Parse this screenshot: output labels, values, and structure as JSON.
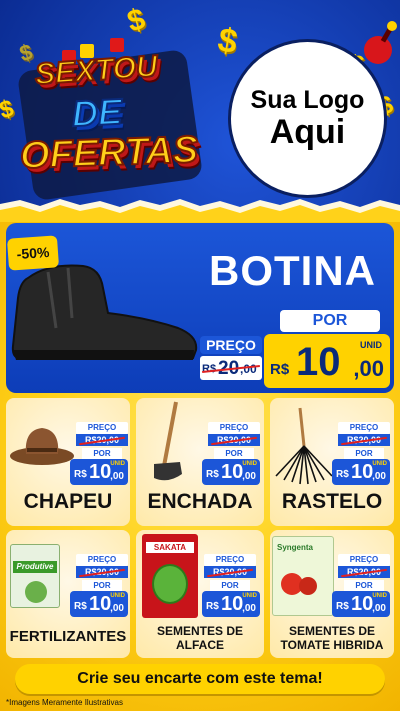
{
  "header": {
    "logo_line1": "SEXTOU",
    "logo_line2": "DE",
    "logo_line3": "OFERTAS",
    "brand_circle_line1": "Sua Logo",
    "brand_circle_line2": "Aqui",
    "dollar_glyph": "$"
  },
  "hero": {
    "discount_badge": "-50%",
    "title": "BOTINA",
    "preco_label": "PREÇO",
    "old_price_currency": "R$",
    "old_price_int": "20",
    "old_price_dec": ",00",
    "por_label": "POR",
    "unid_label": "UNID",
    "new_price_currency": "R$",
    "new_price_int": "10",
    "new_price_dec": ",00"
  },
  "products": [
    {
      "name": "CHAPEU",
      "preco": "PREÇO",
      "old": "R$20,00",
      "por": "POR",
      "cur": "R$",
      "int": "10",
      "dec": ",00",
      "unid": "UNID",
      "icon": "hat-icon"
    },
    {
      "name": "ENCHADA",
      "preco": "PREÇO",
      "old": "R$20,00",
      "por": "POR",
      "cur": "R$",
      "int": "10",
      "dec": ",00",
      "unid": "UNID",
      "icon": "hoe-icon"
    },
    {
      "name": "RASTELO",
      "preco": "PREÇO",
      "old": "R$20,00",
      "por": "POR",
      "cur": "R$",
      "int": "10",
      "dec": ",00",
      "unid": "UNID",
      "icon": "rake-icon"
    },
    {
      "name": "FERTILIZANTES",
      "preco": "PREÇO",
      "old": "R$20,00",
      "por": "POR",
      "cur": "R$",
      "int": "10",
      "dec": ",00",
      "unid": "UNID",
      "icon": "fertilizer-bag-icon",
      "pack_text": "Produtive"
    },
    {
      "name_l1": "SEMENTES DE",
      "name_l2": "ALFACE",
      "preco": "PREÇO",
      "old": "R$20,00",
      "por": "POR",
      "cur": "R$",
      "int": "10",
      "dec": ",00",
      "unid": "UNID",
      "icon": "seed-packet-icon",
      "pack_text": "SAKATA"
    },
    {
      "name_l1": "SEMENTES DE",
      "name_l2": "TOMATE HIBRIDA",
      "preco": "PREÇO",
      "old": "R$20,00",
      "por": "POR",
      "cur": "R$",
      "int": "10",
      "dec": ",00",
      "unid": "UNID",
      "icon": "tomato-seed-packet-icon",
      "pack_text": "Syngenta"
    }
  ],
  "footer": {
    "cta": "Crie seu encarte com este tema!",
    "footnote": "*Imagens Meramente Ilustrativas"
  },
  "colors": {
    "blue": "#1c56d8",
    "yellow": "#ffd200",
    "red_strike": "#e02020"
  }
}
